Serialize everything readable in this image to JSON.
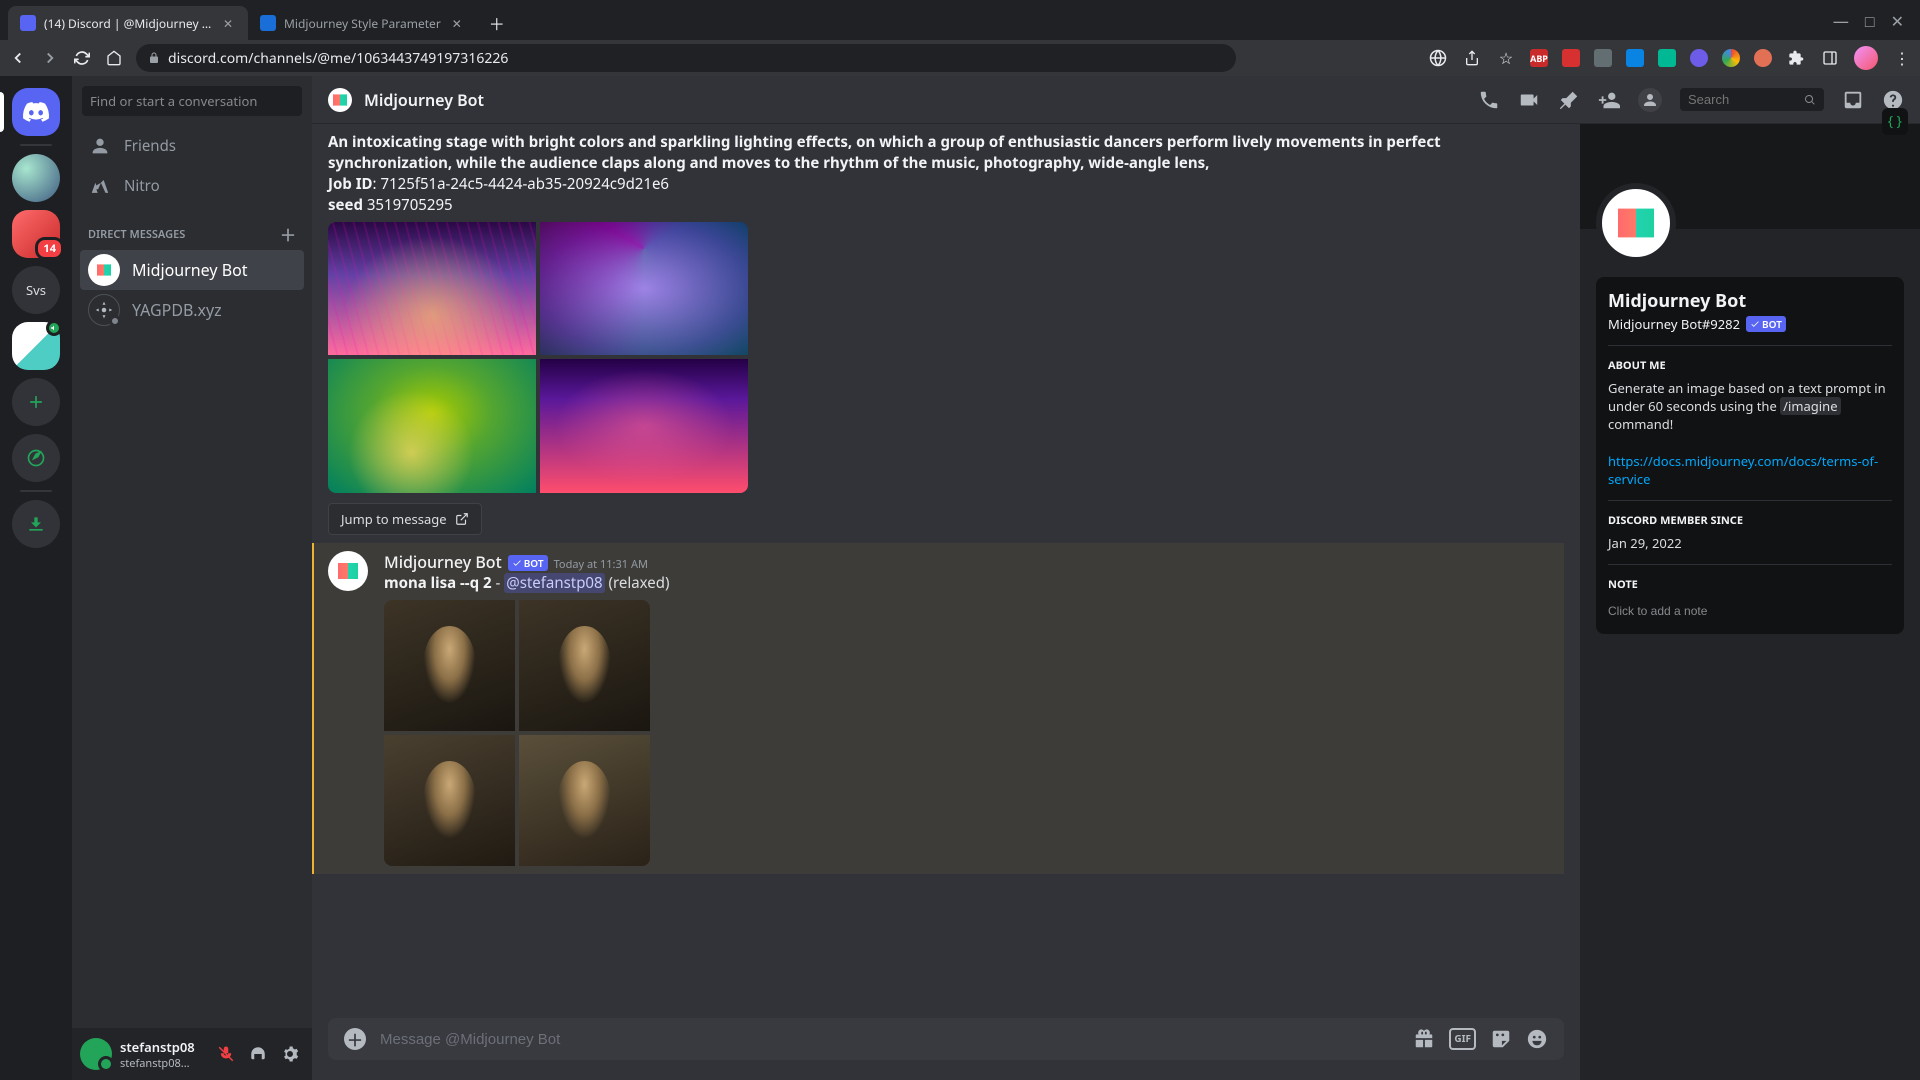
{
  "browser": {
    "tabs": [
      {
        "title": "(14) Discord | @Midjourney Bot",
        "active": true,
        "badge": "14"
      },
      {
        "title": "Midjourney Style Parameter",
        "active": false
      }
    ],
    "url": "discord.com/channels/@me/1063443749197316226"
  },
  "server_rail": {
    "dm_badge": "",
    "servers": [
      {
        "badge": "",
        "type": "img"
      },
      {
        "badge": "14",
        "type": "img2"
      },
      {
        "label": "Svs",
        "type": "text"
      },
      {
        "badge": "",
        "type": "img4",
        "voice": true
      }
    ]
  },
  "sidebar": {
    "find_placeholder": "Find or start a conversation",
    "friends_label": "Friends",
    "nitro_label": "Nitro",
    "dm_header": "Direct Messages",
    "dms": [
      {
        "name": "Midjourney Bot",
        "selected": true
      },
      {
        "name": "YAGPDB.xyz",
        "selected": false
      }
    ]
  },
  "user_panel": {
    "name": "stefanstp08",
    "tag": "stefanstp08..."
  },
  "chat_header": {
    "title": "Midjourney Bot",
    "search_placeholder": "Search"
  },
  "messages": {
    "reply_preview": {
      "text_line1": "An intoxicating stage with bright colors and sparkling lighting effects, on which a group of enthusiastic dancers perform lively movements in perfect",
      "text_line2": "synchronization, while the audience claps along and moves to the rhythm of the music, photography, wide-angle lens,",
      "job_label": "Job ID",
      "job_id": "7125f51a-24c5-4424-ab35-20924c9d21e6",
      "seed_label": "seed",
      "seed": "3519705295",
      "jump_label": "Jump to message"
    },
    "main": {
      "author": "Midjourney Bot",
      "bot_tag": "BOT",
      "timestamp": "Today at 11:31 AM",
      "prompt_bold": "mona lisa --q 2",
      "dash": " - ",
      "mention": "@stefanstp08",
      "suffix": " (relaxed)"
    }
  },
  "composer": {
    "placeholder": "Message @Midjourney Bot",
    "gif_label": "GIF"
  },
  "profile": {
    "name": "Midjourney Bot",
    "tag": "Midjourney Bot#9282",
    "bot_tag": "BOT",
    "about_title": "About Me",
    "about_body_1": "Generate an image based on a text prompt in under 60 seconds using the ",
    "about_cmd": "/imagine",
    "about_body_2": " command!",
    "about_link": "https://docs.midjourney.com/docs/terms-of-service",
    "member_title": "Discord Member Since",
    "member_date": "Jan 29, 2022",
    "note_title": "Note",
    "note_placeholder": "Click to add a note"
  }
}
